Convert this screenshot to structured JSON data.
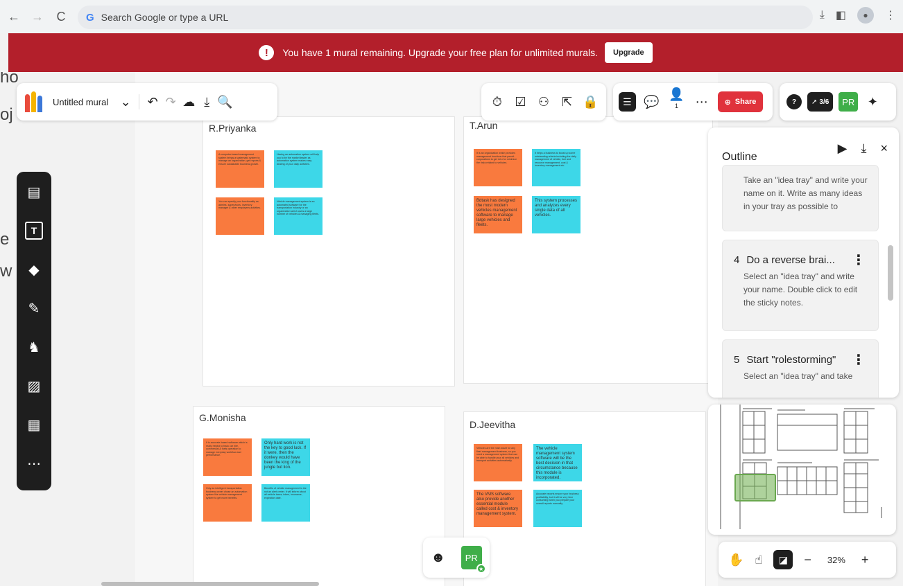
{
  "browser": {
    "omnibox_placeholder": "Search Google or type a URL",
    "google_logo": "G",
    "back_icon": "←",
    "forward_icon": "→",
    "reload_icon": "C",
    "download_icon": "⤓",
    "sidepanel_icon": "◧",
    "menu_icon": "⋮"
  },
  "banner": {
    "icon": "!",
    "message": "You have 1 mural remaining. Upgrade your free plan for unlimited murals.",
    "upgrade_label": "Upgrade"
  },
  "toolbar": {
    "mural_title": "Untitled mural",
    "chevron": "⌄",
    "undo": "↶",
    "redo": "↷",
    "cloud": "☁",
    "download": "⤓",
    "search": "🔍"
  },
  "topright": {
    "timer": "⏱",
    "check": "☑",
    "binoculars": "⚇",
    "cursor": "⇱",
    "lock": "🔒",
    "outline_btn": "☰",
    "comment": "💬",
    "people": "👤",
    "people_count": "1",
    "more": "⋯",
    "share_label": "Share",
    "help": "?",
    "rocket_label": "3/6",
    "pr_label": "PR",
    "sparkle": "✦"
  },
  "left_tools": [
    "▤",
    "T",
    "◆",
    "✎",
    "♞",
    "▨",
    "▦",
    "⋯"
  ],
  "side_text": [
    "ho",
    "oj",
    "e",
    "w"
  ],
  "areas": [
    {
      "title": "R.Priyanka",
      "stickies": [
        {
          "color": "orange",
          "text": "A computer-based management system brings a systematic system to manage an organization, get reports & ensure sustainable business growth."
        },
        {
          "color": "cyan",
          "text": "Having an automation system will help you to be the market leader as automation system makes easy dealing of your daily activities."
        },
        {
          "color": "orange",
          "text": "You can specify your functionality as admins, supervisors, inventory manager & other employees activities."
        },
        {
          "color": "cyan",
          "text": "Vehicle management system is an automated software for the transportation industry or an organization which owns a large number of vehicles & managing fleets."
        }
      ]
    },
    {
      "title": "T.Arun",
      "stickies": [
        {
          "color": "orange",
          "text": "It is an organization which provides management functions that permit corporations to get rid of or minimize the risks related to vehicles."
        },
        {
          "color": "cyan",
          "text": "It helps a business to boost up some outstanding criteria including the daily management of vehicle, fuel and resource management, cost & inventory management etc."
        },
        {
          "color": "orange",
          "text": "Bdtask has designed the most modern vehicles management software to manage large vehicles and fleets.",
          "big": true
        },
        {
          "color": "cyan",
          "text": "This system processes and analyzes every single data of all vehicles.",
          "big": true
        }
      ]
    },
    {
      "title": "G.Monisha",
      "stickies": [
        {
          "color": "orange",
          "text": "It is accurate-based software which is really helpful to track car hire, commercial & fuels operation to manage everyday workflow and performance."
        },
        {
          "color": "cyan",
          "text": "Only hard work is not the key to good luck. If it were, then the donkey would have been the king of the jungle but lion.",
          "big": true
        },
        {
          "color": "orange",
          "text": "Only an intelligent transportation business owner chose an automation system like vehicle management system to get more benefits."
        },
        {
          "color": "cyan",
          "text": "Benefits of vehicle management is the not an alert center. It will inform about all vehicle taxes, token, insurance, expiration date."
        }
      ]
    },
    {
      "title": "D.Jeevitha",
      "stickies": [
        {
          "color": "orange",
          "text": "Vehicles are the main asset for any fleet management business, so you need a management system that can be able to handle your all vehicles and transport activities automatically."
        },
        {
          "color": "cyan",
          "text": "The vehicle management system software will be the best decision in that circumstance because this module is incorporated.",
          "big": true
        },
        {
          "color": "orange",
          "text": "The VMS software also provide another essential module called cost & inventory management system.",
          "big": true
        },
        {
          "color": "cyan",
          "text": "Accurate reports ensure your business profitability, but it will be very time consuming when you prepare your overall reports manually."
        }
      ]
    }
  ],
  "outline": {
    "title": "Outline",
    "present_icon": "▶",
    "download_icon": "⤓",
    "close_icon": "×",
    "steps": [
      {
        "num": "",
        "heading": "",
        "body": "Take an \"idea tray\" and write your name on it. Write as many ideas in your tray as possible to"
      },
      {
        "num": "4",
        "heading": "Do a reverse brai...",
        "body": "Select an \"idea tray\" and write your name. Double click to edit the sticky notes."
      },
      {
        "num": "5",
        "heading": "Start \"rolestorming\"",
        "body": "Select an \"idea tray\" and take"
      }
    ],
    "menu_icon": "⋮"
  },
  "zoom": {
    "hand": "✋",
    "pointer": "☝",
    "select": "◪",
    "minus": "−",
    "value": "32%",
    "plus": "+"
  },
  "reactions": {
    "emoji": "☻",
    "avatar": "PR",
    "badge": "★"
  }
}
